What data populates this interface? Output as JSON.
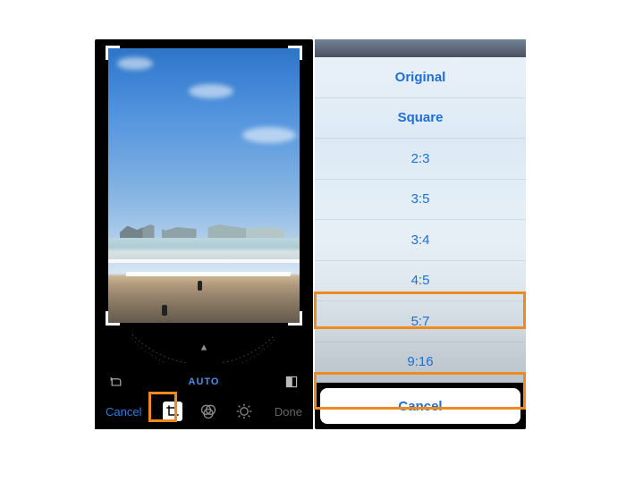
{
  "left": {
    "auto_label": "AUTO",
    "cancel": "Cancel",
    "done": "Done"
  },
  "sheet": {
    "items": [
      {
        "label": "Original",
        "bold": true
      },
      {
        "label": "Square",
        "bold": true
      },
      {
        "label": "2:3",
        "bold": false
      },
      {
        "label": "3:5",
        "bold": false
      },
      {
        "label": "3:4",
        "bold": false
      },
      {
        "label": "4:5",
        "bold": false
      },
      {
        "label": "5:7",
        "bold": false
      },
      {
        "label": "9:16",
        "bold": false
      }
    ],
    "cancel": "Cancel"
  },
  "highlights": {
    "crop_tool": true,
    "ratio_4_5": true,
    "ratio_9_16": true
  },
  "colors": {
    "accent": "#1e6fd6",
    "highlight": "#f08a1c"
  }
}
